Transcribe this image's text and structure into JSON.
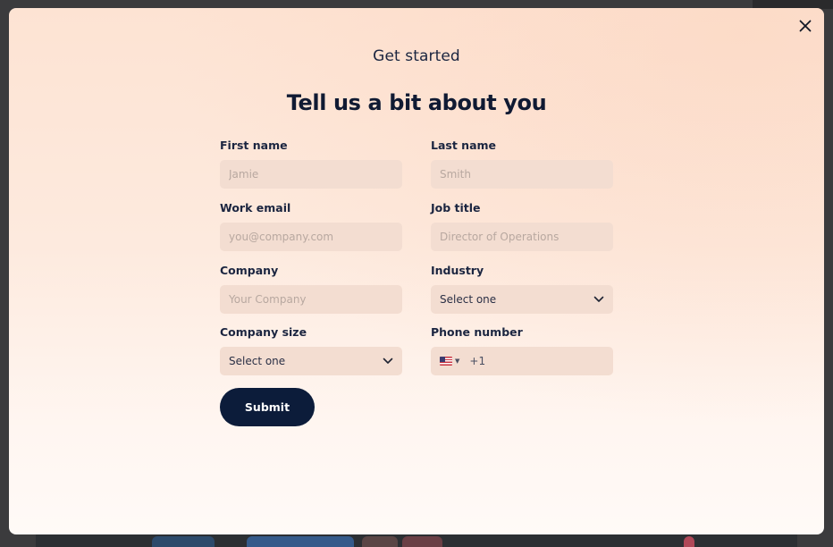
{
  "modal": {
    "subtitle": "Get started",
    "title": "Tell us a bit about you",
    "close_icon": "close-icon"
  },
  "form": {
    "first_name": {
      "label": "First name",
      "placeholder": "Jamie"
    },
    "last_name": {
      "label": "Last name",
      "placeholder": "Smith"
    },
    "work_email": {
      "label": "Work email",
      "placeholder": "you@company.com"
    },
    "job_title": {
      "label": "Job title",
      "placeholder": "Director of Operations"
    },
    "company": {
      "label": "Company",
      "placeholder": "Your Company"
    },
    "industry": {
      "label": "Industry",
      "value": "Select one"
    },
    "company_size": {
      "label": "Company size",
      "value": "Select one"
    },
    "phone_number": {
      "label": "Phone number",
      "country_flag": "us-flag-icon",
      "dial_code": "+1"
    },
    "submit_label": "Submit"
  },
  "colors": {
    "accent": "#0c1c3a",
    "field_bg": "#f3ddd1",
    "text": "#1b2540"
  }
}
